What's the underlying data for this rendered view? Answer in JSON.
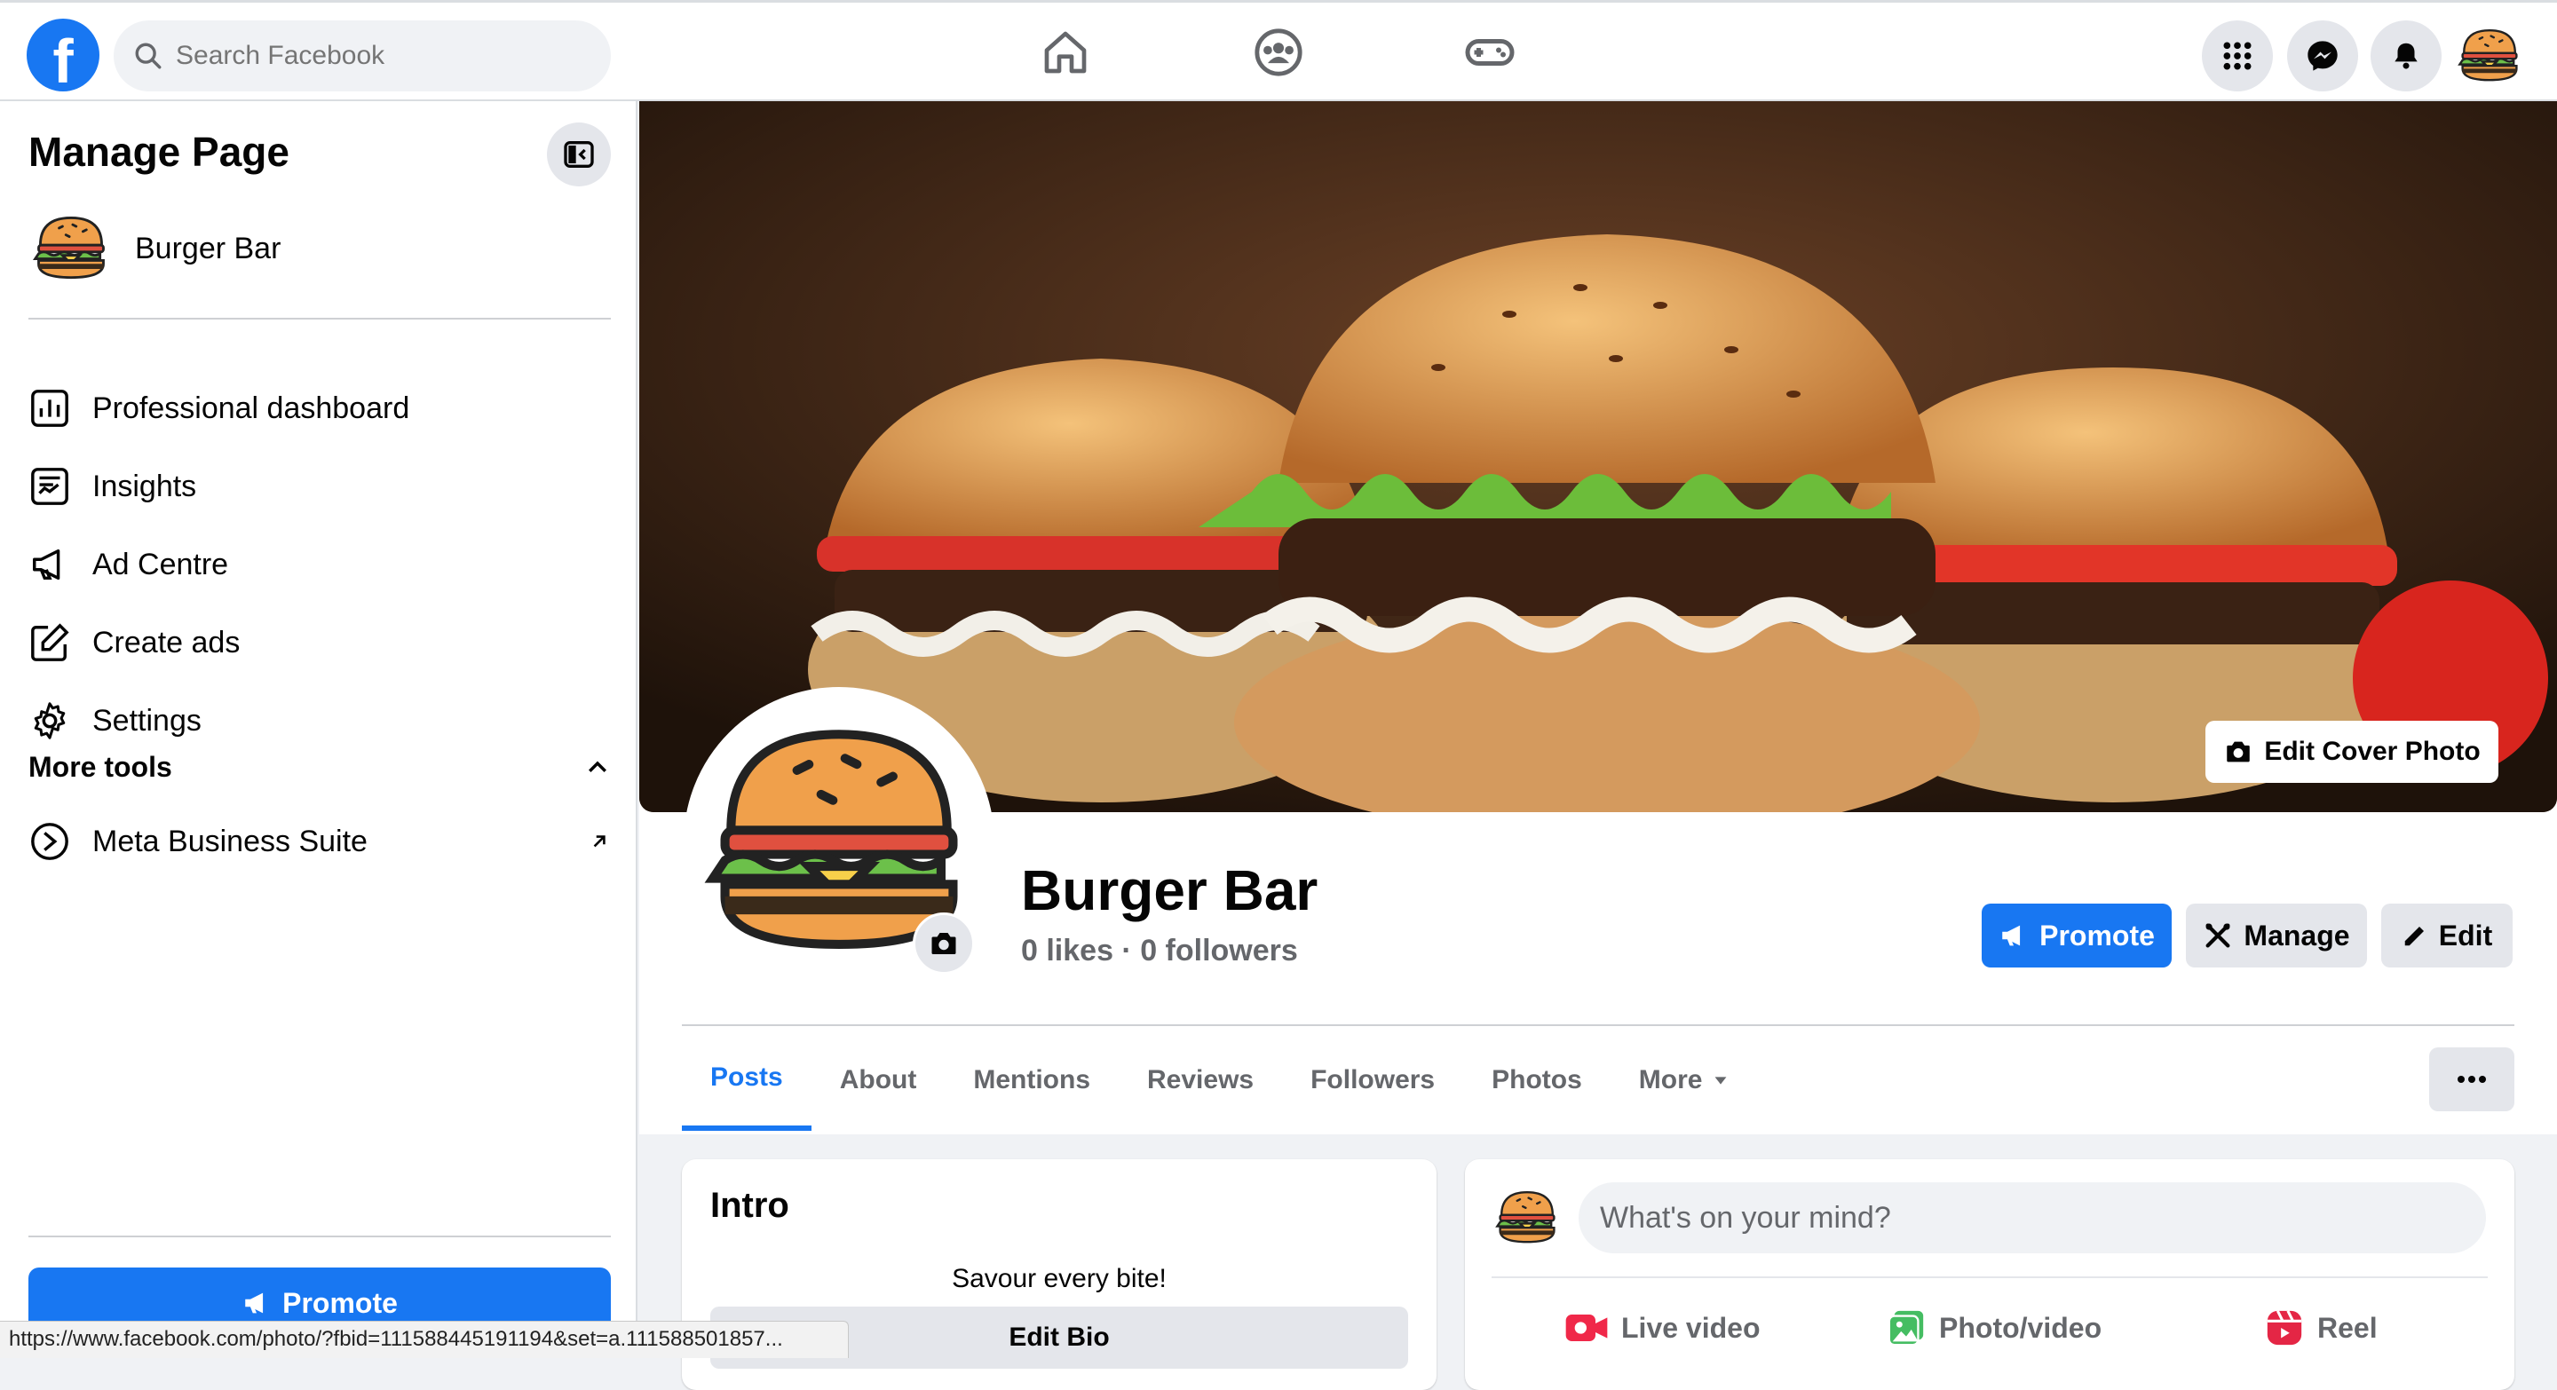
{
  "topbar": {
    "search_placeholder": "Search Facebook",
    "brand_logo_letter": "f",
    "nav_icons": [
      "home-icon",
      "groups-icon",
      "gaming-icon"
    ],
    "right_icons": [
      "menu-grid-icon",
      "messenger-icon",
      "notifications-icon",
      "profile-avatar"
    ],
    "brand_color": "#1877f2"
  },
  "sidebar": {
    "title": "Manage Page",
    "page_name": "Burger Bar",
    "items": [
      {
        "label": "Professional dashboard",
        "icon": "dashboard-icon"
      },
      {
        "label": "Insights",
        "icon": "insights-icon"
      },
      {
        "label": "Ad Centre",
        "icon": "megaphone-icon"
      },
      {
        "label": "Create ads",
        "icon": "edit-icon"
      },
      {
        "label": "Settings",
        "icon": "gear-icon"
      }
    ],
    "more_tools_label": "More tools",
    "meta_suite_label": "Meta Business Suite",
    "promote_label": "Promote"
  },
  "profile": {
    "edit_cover_label": "Edit Cover Photo",
    "name": "Burger Bar",
    "stats": "0 likes · 0 followers",
    "promote_label": "Promote",
    "manage_label": "Manage",
    "edit_label": "Edit"
  },
  "tabs": [
    "Posts",
    "About",
    "Mentions",
    "Reviews",
    "Followers",
    "Photos",
    "More"
  ],
  "intro": {
    "title": "Intro",
    "bio": "Savour every bite!",
    "edit_bio_label": "Edit Bio"
  },
  "composer": {
    "placeholder": "What's on your mind?",
    "actions": [
      {
        "label": "Live video",
        "color": "#f02849"
      },
      {
        "label": "Photo/video",
        "color": "#45bd62"
      },
      {
        "label": "Reel",
        "color": "#e42645"
      }
    ]
  },
  "status_url": "https://www.facebook.com/photo/?fbid=111588445191194&set=a.111588501857..."
}
